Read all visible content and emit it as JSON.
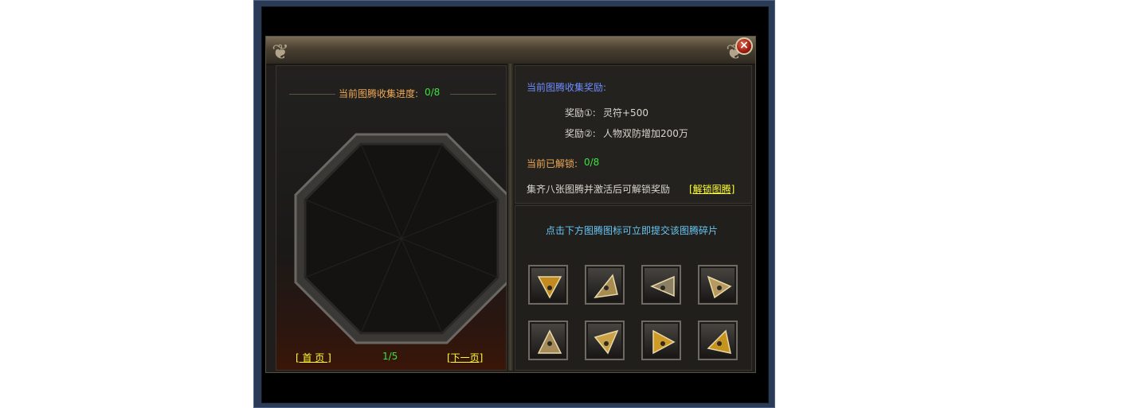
{
  "header": {
    "close_label": "×"
  },
  "left": {
    "progress_label": "当前图腾收集进度:",
    "progress_value": "0/8",
    "first_page": "[ 首 页 ]",
    "page_indicator": "1/5",
    "next_page": "[下一页]"
  },
  "right": {
    "reward_title": "当前图腾收集奖励:",
    "reward1_label": "奖励①:",
    "reward1_value": "灵符+500",
    "reward2_label": "奖励②:",
    "reward2_value": "人物双防增加200万",
    "unlocked_label": "当前已解锁:",
    "unlocked_value": "0/8",
    "hint": "集齐八张图腾并激活后可解锁奖励",
    "unlock_link": "[解锁图腾]",
    "submit_hint": "点击下方图腾图标可立即提交该图腾碎片"
  },
  "fragments": [
    {
      "icon": "totem-fragment-1-icon",
      "color": "#c28a1f"
    },
    {
      "icon": "totem-fragment-2-icon",
      "color": "#a88b52"
    },
    {
      "icon": "totem-fragment-3-icon",
      "color": "#8a7e63"
    },
    {
      "icon": "totem-fragment-4-icon",
      "color": "#b69a5f"
    },
    {
      "icon": "totem-fragment-5-icon",
      "color": "#a58c5a"
    },
    {
      "icon": "totem-fragment-6-icon",
      "color": "#c9a248"
    },
    {
      "icon": "totem-fragment-7-icon",
      "color": "#d09a26"
    },
    {
      "icon": "totem-fragment-8-icon",
      "color": "#c7931f"
    }
  ]
}
